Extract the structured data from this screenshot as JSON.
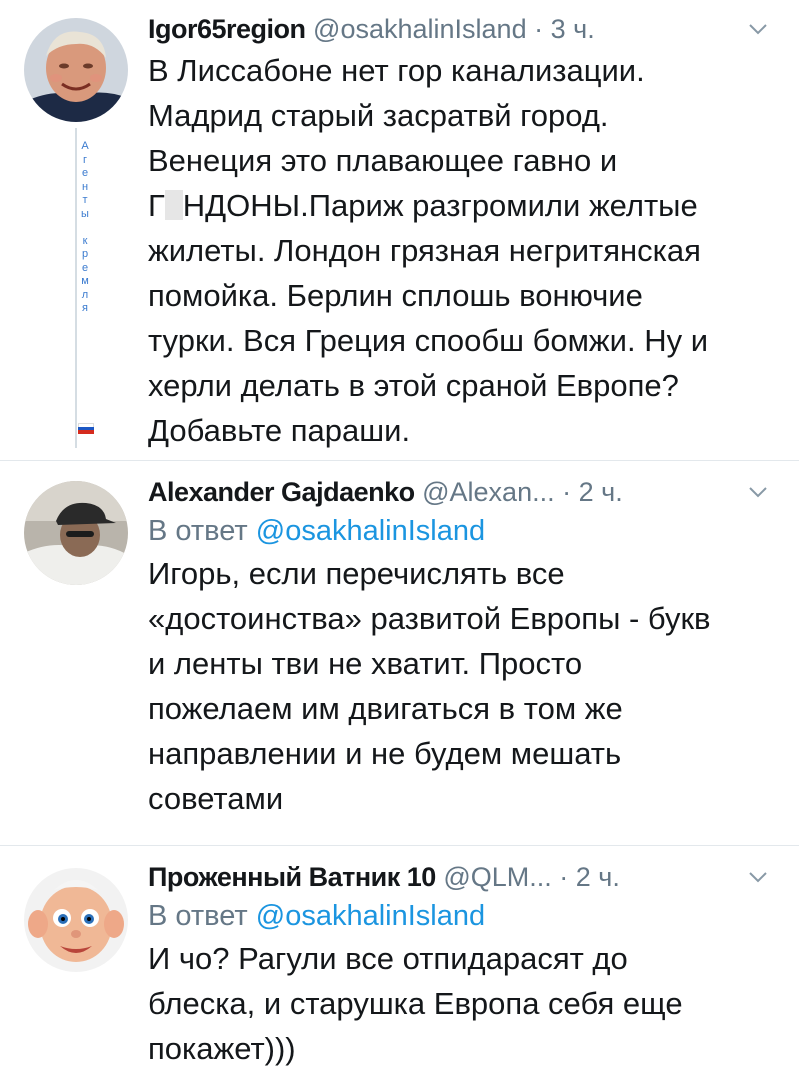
{
  "tweets": [
    {
      "name": "Igor65region",
      "handle": "@osakhalinIsland",
      "separator": "·",
      "time": "3 ч.",
      "lines": [
        "В Лиссабоне нет гор канализации.",
        "Мадрид старый засратвй город.",
        "Венеция это плавающее гавно и",
        "Г",
        "НДОНЫ.Париж разгромили желтые",
        "жилеты. Лондон грязная негритянская",
        "помойка. Берлин сплошь вонючие",
        "турки. Вся Греция спообш бомжи. Ну и",
        "херли делать в этой сраной Европе?",
        "Добавьте параши."
      ],
      "side_label": [
        "А",
        "г",
        "е",
        "н",
        "т",
        "ы",
        "",
        "к",
        "р",
        "е",
        "м",
        "л",
        "я"
      ],
      "avatar_icon": "avatar-older-man-icon",
      "chevron_icon": "chevron-down-icon"
    },
    {
      "name": "Alexander Gajdaenko",
      "handle": "@Alexan...",
      "separator": "·",
      "time": "2 ч.",
      "reply_prefix": "В ответ",
      "reply_to": "@osakhalinIsland",
      "lines": [
        "Игорь, если перечислять все",
        "«достоинства» развитой Европы - букв",
        "и ленты тви не хватит. Просто",
        "пожелаем им двигаться в том же",
        "направлении и не будем мешать",
        "советами"
      ],
      "avatar_icon": "avatar-man-in-cap-icon",
      "chevron_icon": "chevron-down-icon"
    },
    {
      "name": "Проженный Ватник 10",
      "handle": "@QLM...",
      "separator": "·",
      "time": "2 ч.",
      "reply_prefix": "В ответ",
      "reply_to": "@osakhalinIsland",
      "lines": [
        "И чо? Рагули все отпидарасят до",
        "блеска, и старушка Европа себя еще",
        "покажет)))"
      ],
      "avatar_icon": "avatar-doll-icon",
      "chevron_icon": "chevron-down-icon"
    }
  ],
  "colors": {
    "text": "#14171a",
    "muted": "#657786",
    "link": "#1b95e0",
    "divider": "#e3e8ec"
  }
}
